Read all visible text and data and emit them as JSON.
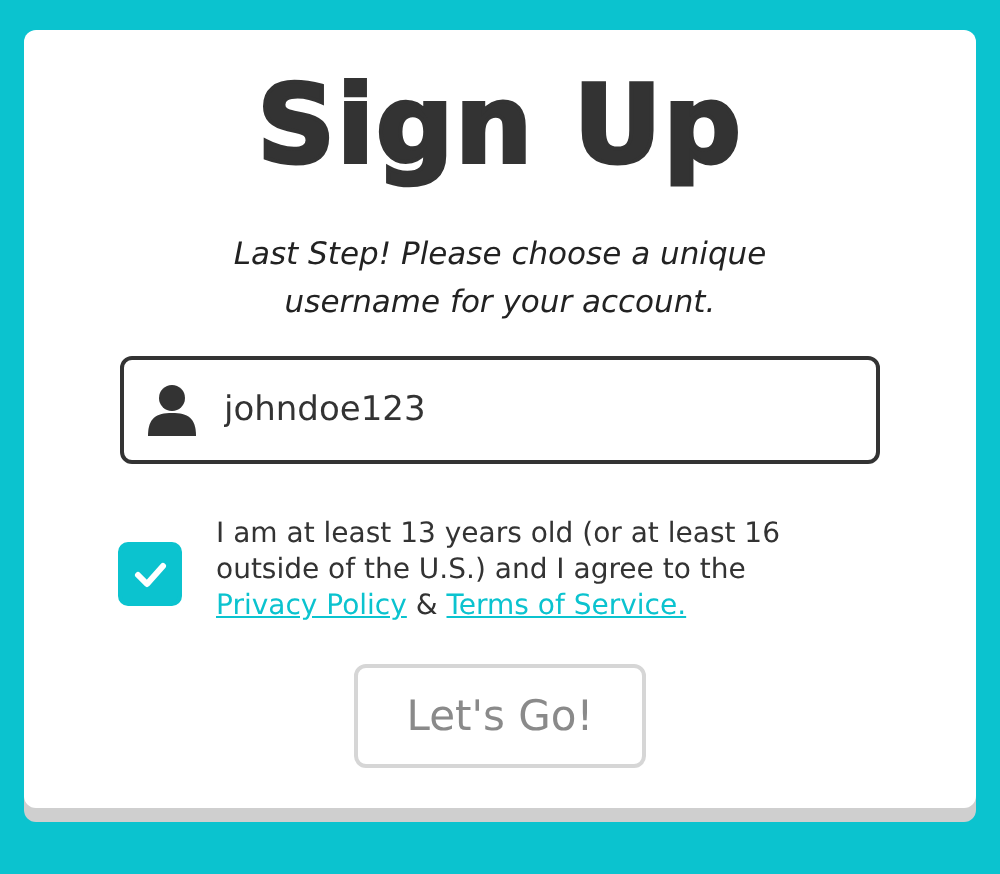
{
  "title": "Sign Up",
  "subtitle": "Last Step! Please choose a unique username for your account.",
  "username_field": {
    "value": "johndoe123"
  },
  "consent": {
    "checked": true,
    "text": "I am at least 13 years old (or at least 16 outside of the U.S.) and I agree to the",
    "links": [
      {
        "label": "Privacy Policy"
      },
      {
        "label": "Terms of Service."
      }
    ],
    "joiner": "&"
  },
  "submit_button": {
    "label": "Let's Go!",
    "disabled": true
  }
}
